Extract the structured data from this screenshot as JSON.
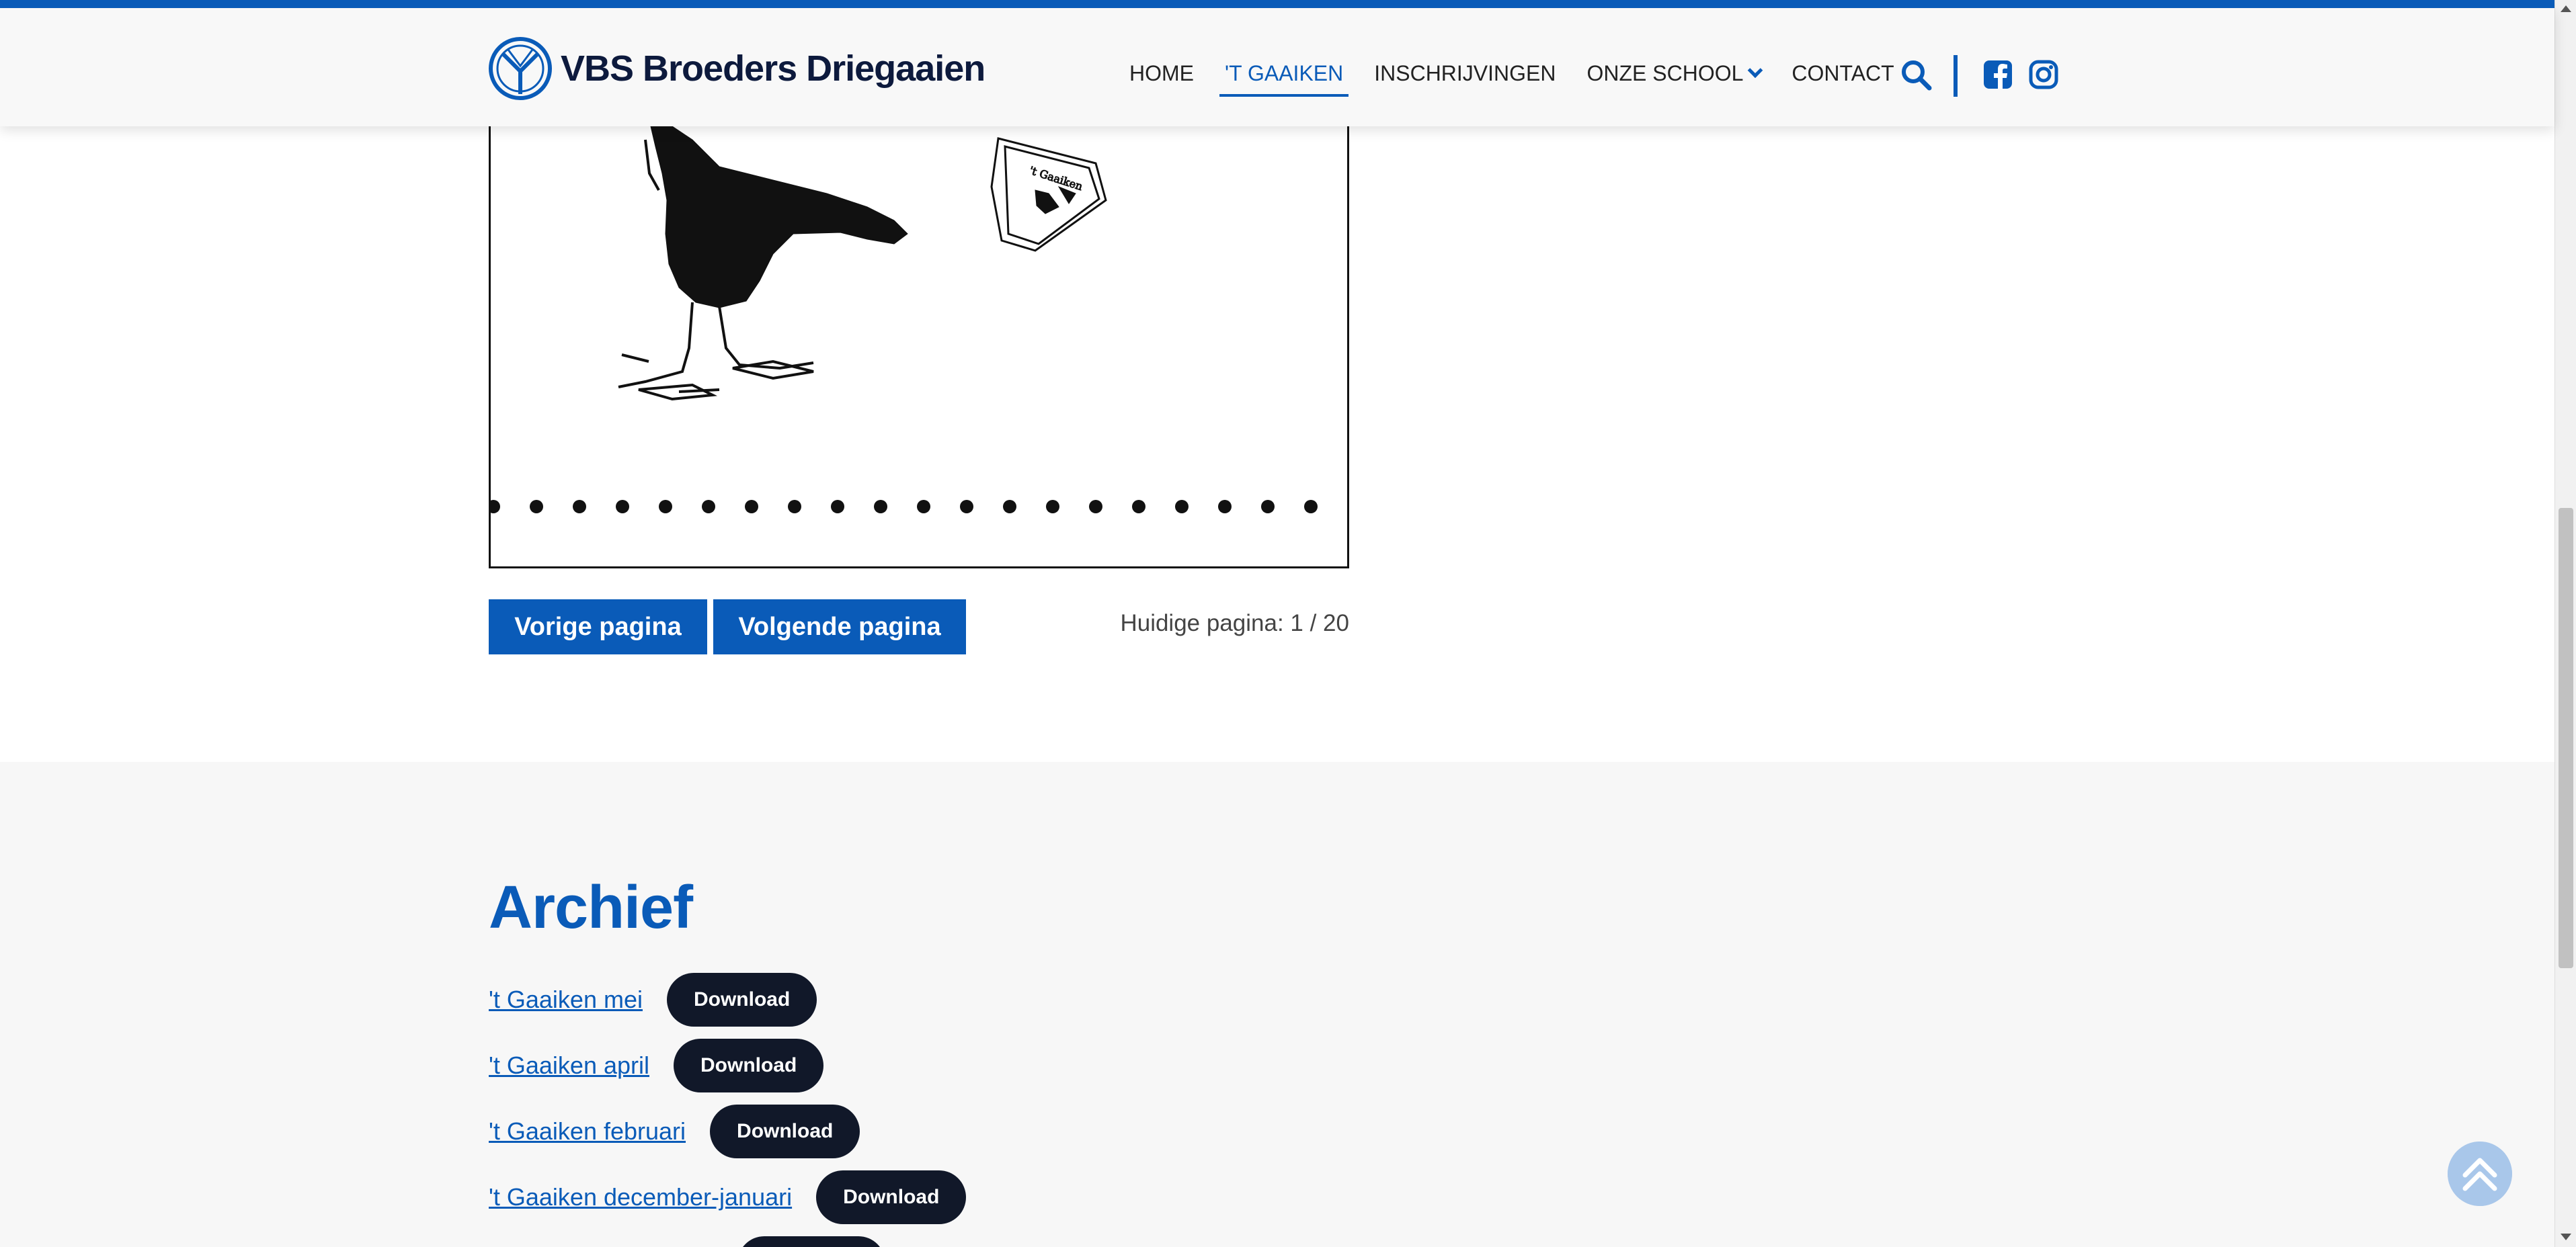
{
  "colors": {
    "accent": "#0a5bb8",
    "dark_button": "#111829",
    "archive_bg": "#f7f7f7",
    "to_top_bg": "#a9c7ea"
  },
  "header": {
    "logo_text": "VBS Broeders Driegaaien",
    "nav": [
      {
        "label": "HOME",
        "active": false
      },
      {
        "label": "'T GAAIKEN",
        "active": true
      },
      {
        "label": "INSCHRIJVINGEN",
        "active": false
      },
      {
        "label": "ONZE SCHOOL",
        "active": false,
        "has_dropdown": true
      },
      {
        "label": "CONTACT",
        "active": false
      }
    ],
    "icons": [
      "search-icon",
      "facebook-icon",
      "instagram-icon"
    ]
  },
  "viewer": {
    "prev_label": "Vorige pagina",
    "next_label": "Volgende pagina",
    "page_indicator": "Huidige pagina: 1 / 20"
  },
  "archive": {
    "title": "Archief",
    "download_label": "Download",
    "items": [
      {
        "label": "'t Gaaiken mei"
      },
      {
        "label": "'t Gaaiken april"
      },
      {
        "label": "'t Gaaiken februari"
      },
      {
        "label": "'t Gaaiken december-januari"
      }
    ]
  }
}
